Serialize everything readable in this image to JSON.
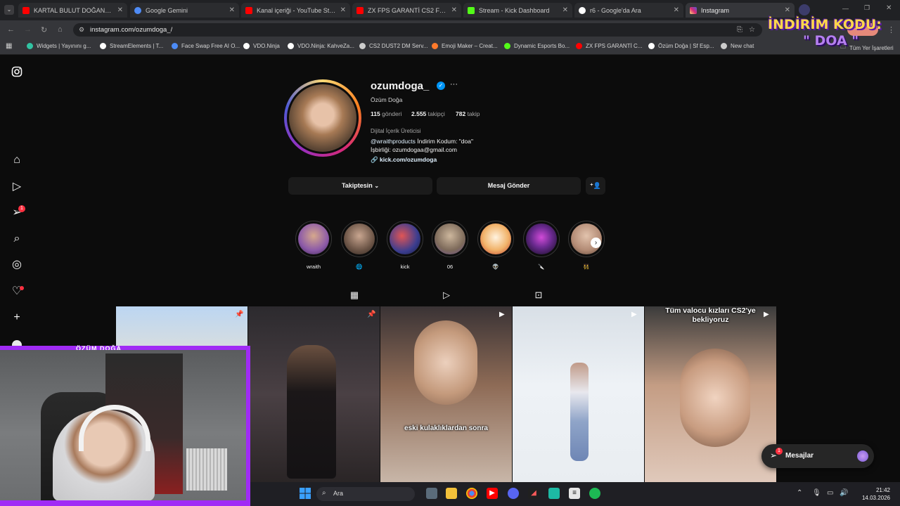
{
  "browser": {
    "tabs": [
      {
        "title": "KARTAL BULUT DOĞAN JAHRI",
        "fav_color": "#ff0000"
      },
      {
        "title": "Google Gemini",
        "fav_color": "#4f8cf7"
      },
      {
        "title": "Kanal içeriği - YouTube Studio",
        "fav_color": "#ff0000"
      },
      {
        "title": "ZX FPS GARANTİ CS2 FPS ART",
        "fav_color": "#ff0000"
      },
      {
        "title": "Stream - Kick Dashboard",
        "fav_color": "#53fc18"
      },
      {
        "title": "r6 - Google'da Ara",
        "fav_color": "#ffffff"
      },
      {
        "title": "Instagram",
        "fav_color": "#e1306c"
      }
    ],
    "url": "instagram.com/ozumdoga_/",
    "bookmarks": [
      {
        "label": "Widgets | Yayınını g...",
        "color": "#31c3a2"
      },
      {
        "label": "StreamElements | T...",
        "color": "#ffffff"
      },
      {
        "label": "Face Swap Free AI O...",
        "color": "#4c8bf5"
      },
      {
        "label": "VDO.Ninja",
        "color": "#ffffff"
      },
      {
        "label": "VDO.Ninja: KahveZa...",
        "color": "#ffffff"
      },
      {
        "label": "CS2 DUST2 DM Serv...",
        "color": "#cccccc"
      },
      {
        "label": "Emoji Maker – Creat...",
        "color": "#ff7a2b"
      },
      {
        "label": "Dynamic Esports Bo...",
        "color": "#53fc18"
      },
      {
        "label": "ZX FPS GARANTİ C...",
        "color": "#ff0000"
      },
      {
        "label": "Özüm Doğa | Sf Esp...",
        "color": "#ffffff"
      },
      {
        "label": "New chat",
        "color": "#cccccc"
      }
    ],
    "all_bookmarks": "Tüm Yer İşaretleri"
  },
  "profile": {
    "username": "ozumdoga_",
    "full_name": "Özüm Doğa",
    "stats": {
      "posts_count": "115",
      "posts_label": "gönderi",
      "followers_count": "2.555",
      "followers_label": "takipçi",
      "following_count": "782",
      "following_label": "takip"
    },
    "category": "Dijital İçerik Üreticisi",
    "bio_mention": "@wraithproducts",
    "bio_rest": " İndirim Kodum: \"doa\"",
    "bio_line2": "İşbirliği: ozumdogaa@gmail.com",
    "link": "kick.com/ozumdoga",
    "following_button": "Takiptesin",
    "message_button": "Mesaj Gönder"
  },
  "highlights": [
    {
      "label": "wraith",
      "color": "#8c5aa8"
    },
    {
      "label": "🌐",
      "color": "#6b5446"
    },
    {
      "label": "kick",
      "color": "#3a3d8f"
    },
    {
      "label": "06",
      "color": "#7d6a5a"
    },
    {
      "label": "👽",
      "color": "#e6a86a"
    },
    {
      "label": "🔪",
      "color": "#6a2a8f"
    },
    {
      "label": "👯",
      "color": "#b28a74"
    }
  ],
  "posts": [
    {
      "caption": "",
      "bg": "linear-gradient(180deg,#bcd6f2 0%,#e9e2d3 40%,#caa47e 100%)",
      "overlay": "📌"
    },
    {
      "caption": "",
      "bg": "linear-gradient(180deg,#2c2a2e 0%,#4a4044 50%,#2a2526 100%)",
      "overlay": "📌"
    },
    {
      "caption": "eski kulaklıklardan sonra",
      "bg": "linear-gradient(180deg,#3a3335 0%,#8e6b56 45%,#c8b6a8 100%)",
      "overlay": "▶"
    },
    {
      "caption": "",
      "bg": "linear-gradient(180deg,#d8dfe6 0%,#eef2f6 45%,#e9edf1 100%)",
      "overlay": "▶"
    },
    {
      "caption": "Tüm valocu kızları CS2'ye bekliyoruz",
      "bg": "linear-gradient(180deg,#3b3b3b 0%,#c49d84 45%,#e0c9bb 100%)",
      "overlay": "▶"
    }
  ],
  "webcam": {
    "title": "ÖZÜM DOĞA"
  },
  "messages": {
    "label": "Mesajlar",
    "badge": "1"
  },
  "nav": {
    "notifications_badge": "1"
  },
  "promo": {
    "line1": "İNDİRİM KODU:",
    "line2": "\" DOA \""
  },
  "taskbar": {
    "search_label": "Ara",
    "time": "21:42",
    "date": "14.03.2026"
  },
  "colors": {
    "accent_blue": "#0095f6",
    "badge_red": "#ff3040",
    "webcam_frame": "#a02bf5",
    "promo_yellow": "#ffd84a"
  }
}
